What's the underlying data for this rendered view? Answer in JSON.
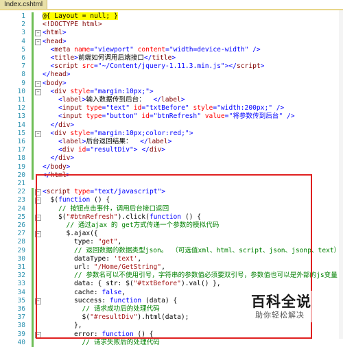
{
  "tab": {
    "title": "Index.cshtml"
  },
  "lines": [
    {
      "n": "1",
      "indent": 0,
      "fold": "",
      "segs": [
        [
          "razor",
          "@{ Layout = null; }"
        ]
      ]
    },
    {
      "n": "2",
      "indent": 0,
      "fold": "",
      "segs": [
        [
          "tag",
          "<!DOCTYPE html>"
        ]
      ]
    },
    {
      "n": "3",
      "indent": 0,
      "fold": "-",
      "segs": [
        [
          "bl",
          "<"
        ],
        [
          "tag",
          "html"
        ],
        [
          "bl",
          ">"
        ]
      ]
    },
    {
      "n": "4",
      "indent": 0,
      "fold": "-",
      "segs": [
        [
          "bl",
          "<"
        ],
        [
          "tag",
          "head"
        ],
        [
          "bl",
          ">"
        ]
      ]
    },
    {
      "n": "5",
      "indent": 1,
      "fold": "",
      "segs": [
        [
          "bl",
          "<"
        ],
        [
          "tag",
          "meta "
        ],
        [
          "attr",
          "name"
        ],
        [
          "bl",
          "=\""
        ],
        [
          "val",
          "viewport"
        ],
        [
          "bl",
          "\" "
        ],
        [
          "attr",
          "content"
        ],
        [
          "bl",
          "=\""
        ],
        [
          "val",
          "width=device-width"
        ],
        [
          "bl",
          "\" />"
        ]
      ]
    },
    {
      "n": "6",
      "indent": 1,
      "fold": "",
      "segs": [
        [
          "bl",
          "<"
        ],
        [
          "tag",
          "title"
        ],
        [
          "bl",
          ">"
        ],
        [
          "t",
          "前端如何调用后端接口"
        ],
        [
          "bl",
          "</"
        ],
        [
          "tag",
          "title"
        ],
        [
          "bl",
          ">"
        ]
      ]
    },
    {
      "n": "7",
      "indent": 1,
      "fold": "",
      "segs": [
        [
          "bl",
          "<"
        ],
        [
          "tag",
          "script "
        ],
        [
          "attr",
          "src"
        ],
        [
          "bl",
          "=\""
        ],
        [
          "val",
          "~/Content/jquery-1.11.3.min.js"
        ],
        [
          "bl",
          "\"></"
        ],
        [
          "tag",
          "script"
        ],
        [
          "bl",
          ">"
        ]
      ]
    },
    {
      "n": "8",
      "indent": 0,
      "fold": "",
      "segs": [
        [
          "bl",
          "</"
        ],
        [
          "tag",
          "head"
        ],
        [
          "bl",
          ">"
        ]
      ]
    },
    {
      "n": "9",
      "indent": 0,
      "fold": "-",
      "segs": [
        [
          "bl",
          "<"
        ],
        [
          "tag",
          "body"
        ],
        [
          "bl",
          ">"
        ]
      ]
    },
    {
      "n": "10",
      "indent": 1,
      "fold": "-",
      "segs": [
        [
          "bl",
          "<"
        ],
        [
          "tag",
          "div "
        ],
        [
          "attr",
          "style"
        ],
        [
          "bl",
          "=\""
        ],
        [
          "val",
          "margin:10px;"
        ],
        [
          "bl",
          "\">"
        ]
      ]
    },
    {
      "n": "11",
      "indent": 2,
      "fold": "",
      "segs": [
        [
          "bl",
          "<"
        ],
        [
          "tag",
          "label"
        ],
        [
          "bl",
          ">"
        ],
        [
          "t",
          "输入数据传到后台：  "
        ],
        [
          "bl",
          "</"
        ],
        [
          "tag",
          "label"
        ],
        [
          "bl",
          ">"
        ]
      ]
    },
    {
      "n": "12",
      "indent": 2,
      "fold": "",
      "segs": [
        [
          "bl",
          "<"
        ],
        [
          "tag",
          "input "
        ],
        [
          "attr",
          "type"
        ],
        [
          "bl",
          "=\""
        ],
        [
          "val",
          "text"
        ],
        [
          "bl",
          "\" "
        ],
        [
          "attr",
          "id"
        ],
        [
          "bl",
          "=\""
        ],
        [
          "val",
          "txtBefore"
        ],
        [
          "bl",
          "\" "
        ],
        [
          "attr",
          "style"
        ],
        [
          "bl",
          "=\""
        ],
        [
          "val",
          "width:200px;"
        ],
        [
          "bl",
          "\" />"
        ]
      ]
    },
    {
      "n": "13",
      "indent": 2,
      "fold": "",
      "segs": [
        [
          "bl",
          "<"
        ],
        [
          "tag",
          "input "
        ],
        [
          "attr",
          "type"
        ],
        [
          "bl",
          "=\""
        ],
        [
          "val",
          "button"
        ],
        [
          "bl",
          "\" "
        ],
        [
          "attr",
          "id"
        ],
        [
          "bl",
          "=\""
        ],
        [
          "val",
          "btnRefresh"
        ],
        [
          "bl",
          "\" "
        ],
        [
          "attr",
          "value"
        ],
        [
          "bl",
          "=\""
        ],
        [
          "val",
          "将参数传到后台"
        ],
        [
          "bl",
          "\" />"
        ]
      ]
    },
    {
      "n": "14",
      "indent": 1,
      "fold": "",
      "segs": [
        [
          "bl",
          "</"
        ],
        [
          "tag",
          "div"
        ],
        [
          "bl",
          ">"
        ]
      ]
    },
    {
      "n": "15",
      "indent": 1,
      "fold": "-",
      "segs": [
        [
          "bl",
          "<"
        ],
        [
          "tag",
          "div "
        ],
        [
          "attr",
          "style"
        ],
        [
          "bl",
          "=\""
        ],
        [
          "val",
          "margin:10px;color:red;"
        ],
        [
          "bl",
          "\">"
        ]
      ]
    },
    {
      "n": "16",
      "indent": 2,
      "fold": "",
      "segs": [
        [
          "bl",
          "<"
        ],
        [
          "tag",
          "label"
        ],
        [
          "bl",
          ">"
        ],
        [
          "t",
          "后台返回结果：  "
        ],
        [
          "bl",
          "</"
        ],
        [
          "tag",
          "label"
        ],
        [
          "bl",
          ">"
        ]
      ]
    },
    {
      "n": "17",
      "indent": 2,
      "fold": "",
      "segs": [
        [
          "bl",
          "<"
        ],
        [
          "tag",
          "div "
        ],
        [
          "attr",
          "id"
        ],
        [
          "bl",
          "=\""
        ],
        [
          "val",
          "resultDiv"
        ],
        [
          "bl",
          "\"> </"
        ],
        [
          "tag",
          "div"
        ],
        [
          "bl",
          ">"
        ]
      ]
    },
    {
      "n": "18",
      "indent": 1,
      "fold": "",
      "segs": [
        [
          "bl",
          "</"
        ],
        [
          "tag",
          "div"
        ],
        [
          "bl",
          ">"
        ]
      ]
    },
    {
      "n": "19",
      "indent": 0,
      "fold": "",
      "segs": [
        [
          "bl",
          "</"
        ],
        [
          "tag",
          "body"
        ],
        [
          "bl",
          ">"
        ]
      ]
    },
    {
      "n": "20",
      "indent": 0,
      "fold": "",
      "segs": [
        [
          "bl",
          "</"
        ],
        [
          "tag",
          "html"
        ],
        [
          "bl",
          ">"
        ]
      ]
    },
    {
      "n": "21",
      "indent": 0,
      "fold": "",
      "segs": []
    },
    {
      "n": "22",
      "indent": 0,
      "fold": "-",
      "segs": [
        [
          "bl",
          "<"
        ],
        [
          "tag",
          "script "
        ],
        [
          "attr",
          "type"
        ],
        [
          "bl",
          "=\""
        ],
        [
          "val",
          "text/javascript"
        ],
        [
          "bl",
          "\">"
        ]
      ]
    },
    {
      "n": "23",
      "indent": 1,
      "fold": "-",
      "segs": [
        [
          "t",
          "$("
        ],
        [
          "kw",
          "function"
        ],
        [
          "t",
          " () {"
        ]
      ]
    },
    {
      "n": "24",
      "indent": 2,
      "fold": "",
      "segs": [
        [
          "com",
          "// 按钮点击事件，调用后台接口返回"
        ]
      ]
    },
    {
      "n": "25",
      "indent": 2,
      "fold": "-",
      "segs": [
        [
          "t",
          "$("
        ],
        [
          "str",
          "\"#btnRefresh\""
        ],
        [
          "t",
          ").click("
        ],
        [
          "kw",
          "function"
        ],
        [
          "t",
          " () {"
        ]
      ]
    },
    {
      "n": "26",
      "indent": 3,
      "fold": "",
      "segs": [
        [
          "com",
          "// 通过ajax 的 get方式传递一个参数的模拟代码"
        ]
      ]
    },
    {
      "n": "27",
      "indent": 3,
      "fold": "-",
      "segs": [
        [
          "t",
          "$.ajax({"
        ]
      ]
    },
    {
      "n": "28",
      "indent": 4,
      "fold": "",
      "segs": [
        [
          "t",
          "type: "
        ],
        [
          "str",
          "\"get\""
        ],
        [
          "t",
          ","
        ]
      ]
    },
    {
      "n": "29",
      "indent": 4,
      "fold": "",
      "segs": [
        [
          "com",
          "// 返回数据的数据类型json。 （可选值xml、html、script、json、jsonp、text）"
        ]
      ]
    },
    {
      "n": "30",
      "indent": 4,
      "fold": "",
      "segs": [
        [
          "t",
          "dataType: "
        ],
        [
          "str",
          "'text'"
        ],
        [
          "t",
          ","
        ]
      ]
    },
    {
      "n": "31",
      "indent": 4,
      "fold": "",
      "segs": [
        [
          "t",
          "url: "
        ],
        [
          "str",
          "\"/Home/GetString\""
        ],
        [
          "t",
          ","
        ]
      ]
    },
    {
      "n": "32",
      "indent": 4,
      "fold": "",
      "segs": [
        [
          "com",
          "// 参数名可以不使用引号，字符串的参数值必须要双引号，参数值也可以是外部的js变量"
        ]
      ]
    },
    {
      "n": "33",
      "indent": 4,
      "fold": "",
      "segs": [
        [
          "t",
          "data: { str: $("
        ],
        [
          "str",
          "\"#txtBefore\""
        ],
        [
          "t",
          ").val() },"
        ]
      ]
    },
    {
      "n": "34",
      "indent": 4,
      "fold": "",
      "segs": [
        [
          "t",
          "cache: "
        ],
        [
          "kw",
          "false"
        ],
        [
          "t",
          ","
        ]
      ]
    },
    {
      "n": "35",
      "indent": 4,
      "fold": "-",
      "segs": [
        [
          "t",
          "success: "
        ],
        [
          "kw",
          "function"
        ],
        [
          "t",
          " (data) {"
        ]
      ]
    },
    {
      "n": "36",
      "indent": 5,
      "fold": "",
      "segs": [
        [
          "com",
          "// 请求成功后的处理代码"
        ]
      ]
    },
    {
      "n": "37",
      "indent": 5,
      "fold": "",
      "segs": [
        [
          "t",
          "$("
        ],
        [
          "str",
          "\"#resultDiv\""
        ],
        [
          "t",
          ").html(data);"
        ]
      ]
    },
    {
      "n": "38",
      "indent": 4,
      "fold": "",
      "segs": [
        [
          "t",
          "},"
        ]
      ]
    },
    {
      "n": "39",
      "indent": 4,
      "fold": "-",
      "segs": [
        [
          "t",
          "error: "
        ],
        [
          "kw",
          "function"
        ],
        [
          "t",
          " () {"
        ]
      ]
    },
    {
      "n": "40",
      "indent": 5,
      "fold": "",
      "segs": [
        [
          "com",
          "// 请求失败后的处理代码"
        ]
      ]
    }
  ],
  "watermark": {
    "logo": "百科全说",
    "sub": "助你轻松解决"
  }
}
